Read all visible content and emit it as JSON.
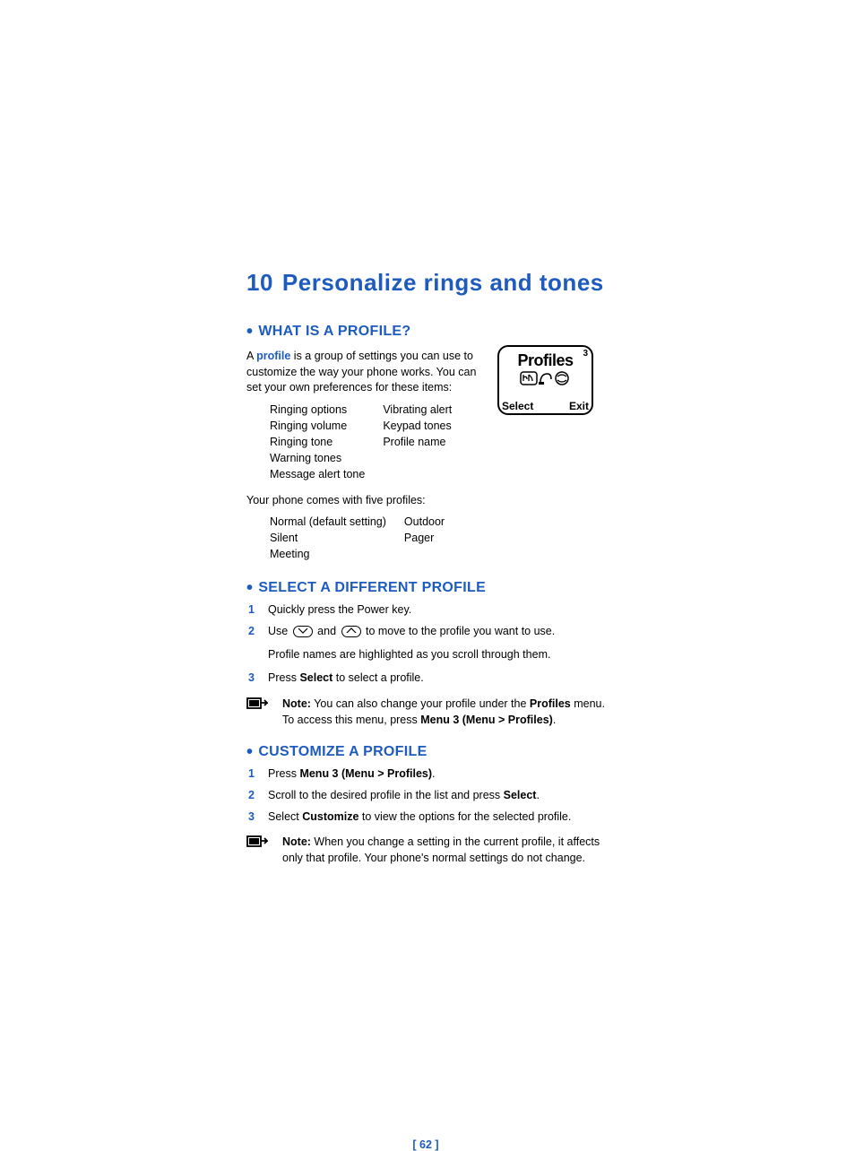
{
  "chapter": {
    "number": "10",
    "title": "Personalize rings and tones"
  },
  "section1": {
    "heading": "WHAT IS A PROFILE?",
    "intro_pre": "A ",
    "intro_link": "profile",
    "intro_post": " is a group of settings you can use to customize the way your phone works. You can set your own preferences for these items:",
    "settings_col1": [
      "Ringing options",
      "Ringing volume",
      "Ringing tone",
      "Warning tones",
      "Message alert tone"
    ],
    "settings_col2": [
      "Vibrating alert",
      "Keypad tones",
      "Profile name"
    ],
    "five_profiles_text": "Your phone comes with five profiles:",
    "profiles_col1": [
      "Normal (default setting)",
      "Silent",
      "Meeting"
    ],
    "profiles_col2": [
      "Outdoor",
      "Pager"
    ]
  },
  "section2": {
    "heading": "SELECT A DIFFERENT PROFILE",
    "step1": "Quickly press the Power key.",
    "step2_pre": "Use  ",
    "step2_mid": "  and  ",
    "step2_post": "  to move to the profile you want to use.",
    "step2_sub": "Profile names are highlighted as you scroll through them.",
    "step3_pre": "Press ",
    "step3_bold": "Select",
    "step3_post": " to select a profile.",
    "note_label": "Note:",
    "note_text1": "  You can also change your profile under the ",
    "note_bold1": "Profiles",
    "note_text2": " menu. To access this menu, press ",
    "note_bold2": "Menu 3 (Menu > Profiles)",
    "note_text3": "."
  },
  "section3": {
    "heading": "CUSTOMIZE A PROFILE",
    "step1_pre": "Press ",
    "step1_bold": "Menu 3 (Menu > Profiles)",
    "step1_post": ".",
    "step2_pre": "Scroll to the desired profile in the list and press ",
    "step2_bold": "Select",
    "step2_post": ".",
    "step3_pre": "Select ",
    "step3_bold": "Customize",
    "step3_post": " to view the options for the selected profile.",
    "note_label": "Note:",
    "note_text": "  When you change a setting in the current profile, it affects only that profile. Your phone's normal settings do not change."
  },
  "screen": {
    "index": "3",
    "title": "Profiles",
    "left_key": "Select",
    "right_key": "Exit"
  },
  "page_number": "[ 62 ]"
}
